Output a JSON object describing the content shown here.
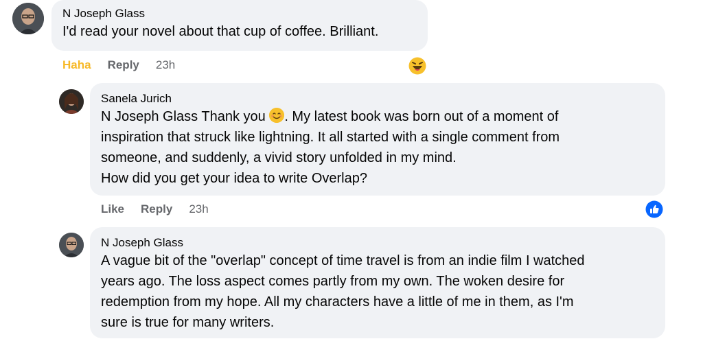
{
  "comments": [
    {
      "author": "N Joseph Glass",
      "text": "I'd read your novel about that cup of coffee. Brilliant.",
      "actions": {
        "reaction_label": "Haha",
        "reply": "Reply",
        "time": "23h"
      },
      "reaction_icon": "haha-emoji-icon"
    },
    {
      "author": "Sanela Jurich",
      "mention": "N Joseph Glass",
      "text_part1": " Thank you ",
      "inline_emoji": "smiling-face-emoji-icon",
      "text_part2": ". My latest book was born out of a moment of",
      "line2": "inspiration that struck like lightning. It all started with a single comment from",
      "line3": "someone, and suddenly, a vivid story unfolded in my mind.",
      "line4": "How did you get your idea to write Overlap?",
      "actions": {
        "like": "Like",
        "reply": "Reply",
        "time": "23h"
      },
      "reaction_icon": "like-thumb-icon"
    },
    {
      "author": "N Joseph Glass",
      "lines": [
        "A vague bit of the \"overlap\" concept of time travel is from an indie film I watched",
        "years ago. The loss aspect comes partly from my own. The woken desire for",
        "redemption from my hope. All my characters have a little of me in them, as I'm",
        "sure is true for many writers."
      ]
    }
  ],
  "colors": {
    "bubble": "#f0f2f5",
    "haha": "#f7b928",
    "like_blue": "#0866ff",
    "meta": "#65676b"
  }
}
